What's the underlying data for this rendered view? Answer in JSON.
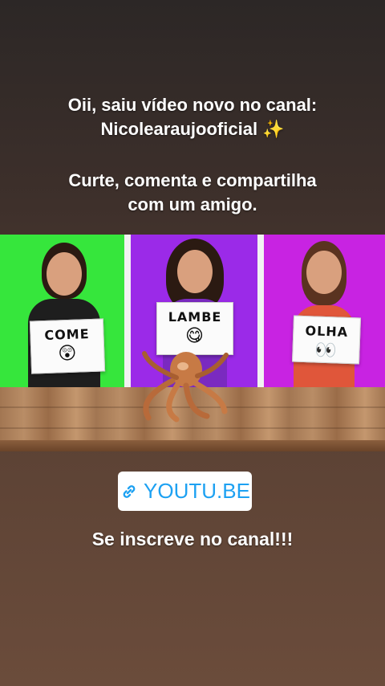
{
  "story": {
    "caption_line1": "Oii, saiu vídeo novo no canal:",
    "caption_line2": "Nicolearaujooficial ✨",
    "caption_line3": "Curte, comenta e compartilha",
    "caption_line4": "com um amigo.",
    "link_label": "YOUTU.BE",
    "subscribe_text": "Se inscreve no canal!!!"
  },
  "thumbnail": {
    "signs": [
      {
        "word": "COME",
        "emoji": "😲"
      },
      {
        "word": "LAMBE",
        "emoji": "😋"
      },
      {
        "word": "OLHA",
        "emoji": "👀"
      }
    ],
    "panel_colors": [
      "#36e63c",
      "#9b2ae8",
      "#c823e2"
    ]
  },
  "icons": {
    "link": "link-icon",
    "sparkles": "sparkles-icon"
  }
}
